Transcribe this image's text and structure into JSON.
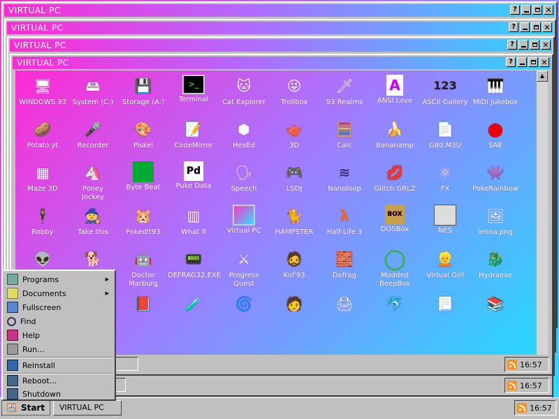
{
  "window_title": "VIRTUAL PC",
  "clock": "16:57",
  "taskbar": {
    "start_label": "Start",
    "task_label": "VIRTUAL PC"
  },
  "start_menu": {
    "items": [
      {
        "label": "Programs",
        "icon": "programs-icon",
        "submenu": true
      },
      {
        "label": "Documents",
        "icon": "documents-icon",
        "submenu": true
      },
      {
        "label": "Fullscreen",
        "icon": "fullscreen-icon"
      },
      {
        "label": "Find",
        "icon": "find-icon"
      },
      {
        "label": "Help",
        "icon": "help-icon"
      },
      {
        "label": "Run...",
        "icon": "run-icon"
      },
      {
        "label": "Reinstall",
        "icon": "reinstall-icon"
      },
      {
        "label": "Reboot...",
        "icon": "reboot-icon"
      },
      {
        "label": "Shutdown",
        "icon": "shutdown-icon"
      }
    ]
  },
  "icons_row1": [
    "WINDOWS 93",
    "System (C:)",
    "Storage (A:)",
    "Terminal",
    "Cat Explorer",
    "Trollbox",
    "93 Realms",
    "ANSI Love",
    "ASCII Gallery",
    "MIDI Jukebox"
  ],
  "icons_row2": [
    "Potato.yt",
    "Recorder",
    "Piskel",
    "CodeMirror",
    "HexEd",
    "3D",
    "Calc",
    "Bananamp",
    "G80.M3U",
    "SAE"
  ],
  "icons_row3": [
    "Maze 3D",
    "Poney\nJockey",
    "Byte Beat",
    "Puke Data",
    "Speech",
    "LSDJ",
    "Nanoloop",
    "Glitch GRLZ",
    "FX",
    "PokeRainbow"
  ],
  "icons_row4": [
    "Robby",
    "Take this",
    "Pokedit93",
    "What If",
    "Virtual PC",
    "HAMPSTER",
    "Half-Life 3",
    "DOSBox",
    "NES",
    "lenna.png"
  ],
  "icons_row5": [
    "",
    "",
    "Doctor\nMarburg",
    "DEFRAG32.EXE",
    "Progress\nQuest",
    "Kof'93",
    "Defrag",
    "Modded\nBeepBox",
    "Virtual Girl",
    "Hydraexe"
  ],
  "colors": {
    "chrome": "#c0c0c0",
    "title_gradient_start": "#ff2ad4",
    "title_gradient_end": "#2bd6ff"
  }
}
